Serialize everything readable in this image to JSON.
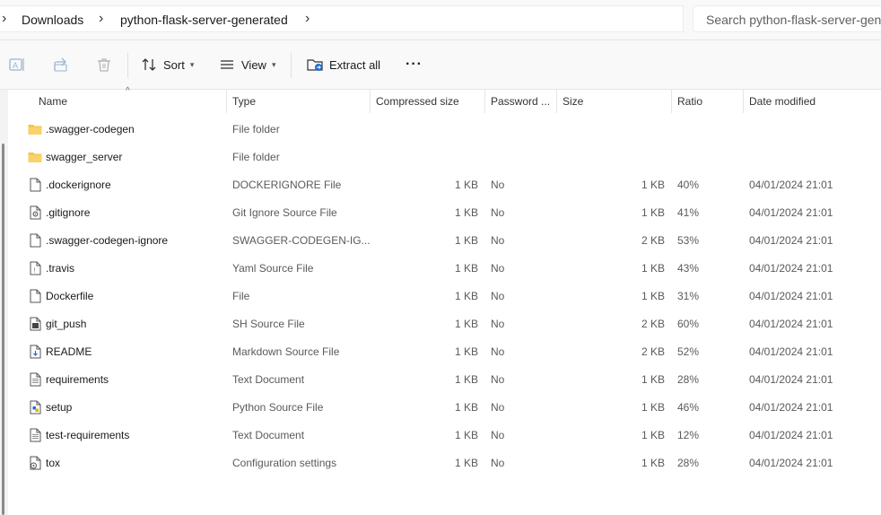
{
  "breadcrumb": [
    "Downloads",
    "python-flask-server-generated"
  ],
  "search": {
    "placeholder": "Search python-flask-server-generated"
  },
  "toolbar": {
    "sort_label": "Sort",
    "view_label": "View",
    "extract_label": "Extract all",
    "more_label": "···"
  },
  "columns": {
    "name": "Name",
    "type": "Type",
    "compressed_size": "Compressed size",
    "password": "Password ...",
    "size": "Size",
    "ratio": "Ratio",
    "date": "Date modified"
  },
  "sort_indicator": "^",
  "files": [
    {
      "name": ".swagger-codegen",
      "type": "File folder",
      "csize": "",
      "pw": "",
      "size": "",
      "ratio": "",
      "date": "",
      "icon": "folder-icon"
    },
    {
      "name": "swagger_server",
      "type": "File folder",
      "csize": "",
      "pw": "",
      "size": "",
      "ratio": "",
      "date": "",
      "icon": "folder-icon"
    },
    {
      "name": ".dockerignore",
      "type": "DOCKERIGNORE File",
      "csize": "1 KB",
      "pw": "No",
      "size": "1 KB",
      "ratio": "40%",
      "date": "04/01/2024 21:01",
      "icon": "file-icon"
    },
    {
      "name": ".gitignore",
      "type": "Git Ignore Source File",
      "csize": "1 KB",
      "pw": "No",
      "size": "1 KB",
      "ratio": "41%",
      "date": "04/01/2024 21:01",
      "icon": "gear-file-icon"
    },
    {
      "name": ".swagger-codegen-ignore",
      "type": "SWAGGER-CODEGEN-IG...",
      "csize": "1 KB",
      "pw": "No",
      "size": "2 KB",
      "ratio": "53%",
      "date": "04/01/2024 21:01",
      "icon": "file-icon"
    },
    {
      "name": ".travis",
      "type": "Yaml Source File",
      "csize": "1 KB",
      "pw": "No",
      "size": "1 KB",
      "ratio": "43%",
      "date": "04/01/2024 21:01",
      "icon": "yaml-file-icon"
    },
    {
      "name": "Dockerfile",
      "type": "File",
      "csize": "1 KB",
      "pw": "No",
      "size": "1 KB",
      "ratio": "31%",
      "date": "04/01/2024 21:01",
      "icon": "file-icon"
    },
    {
      "name": "git_push",
      "type": "SH Source File",
      "csize": "1 KB",
      "pw": "No",
      "size": "2 KB",
      "ratio": "60%",
      "date": "04/01/2024 21:01",
      "icon": "shell-file-icon"
    },
    {
      "name": "README",
      "type": "Markdown Source File",
      "csize": "1 KB",
      "pw": "No",
      "size": "2 KB",
      "ratio": "52%",
      "date": "04/01/2024 21:01",
      "icon": "markdown-file-icon"
    },
    {
      "name": "requirements",
      "type": "Text Document",
      "csize": "1 KB",
      "pw": "No",
      "size": "1 KB",
      "ratio": "28%",
      "date": "04/01/2024 21:01",
      "icon": "text-file-icon"
    },
    {
      "name": "setup",
      "type": "Python Source File",
      "csize": "1 KB",
      "pw": "No",
      "size": "1 KB",
      "ratio": "46%",
      "date": "04/01/2024 21:01",
      "icon": "python-file-icon"
    },
    {
      "name": "test-requirements",
      "type": "Text Document",
      "csize": "1 KB",
      "pw": "No",
      "size": "1 KB",
      "ratio": "12%",
      "date": "04/01/2024 21:01",
      "icon": "text-file-icon"
    },
    {
      "name": "tox",
      "type": "Configuration settings",
      "csize": "1 KB",
      "pw": "No",
      "size": "1 KB",
      "ratio": "28%",
      "date": "04/01/2024 21:01",
      "icon": "config-file-icon"
    }
  ],
  "colors": {
    "folder": "#f2c14e",
    "accent": "#1f6fd1",
    "background": "#ffffff",
    "chrome": "#f9f9f9"
  }
}
